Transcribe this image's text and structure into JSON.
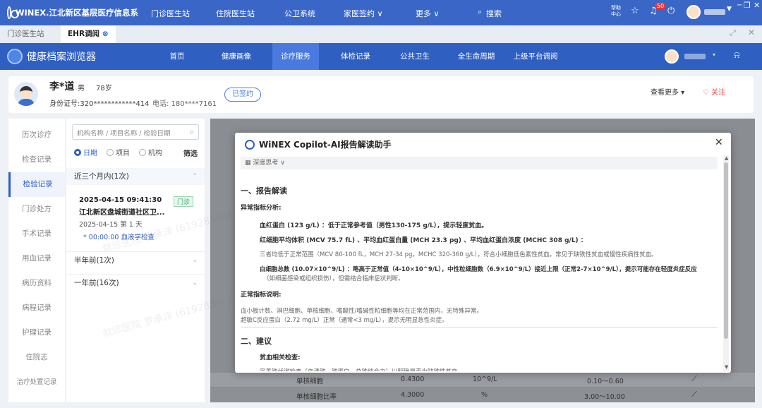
{
  "topbar": {
    "logo": "WINEX.江北新区基层医疗信息系",
    "nav": [
      "门诊医生站",
      "住院医生站",
      "公卫系统",
      "家医签约 ∨",
      "更多 ∨",
      "搜索"
    ],
    "help": "帮助中心",
    "notice_badge": "50"
  },
  "tabs": [
    "门诊医生站",
    "EHR调阅"
  ],
  "app": {
    "title": "健康档案浏览器",
    "nav": [
      "首页",
      "健康画像",
      "诊疗服务",
      "体检记录",
      "公共卫生",
      "全生命周期",
      "上级平台调阅"
    ]
  },
  "patient": {
    "name": "李*道",
    "sex": "男",
    "age": "78岁",
    "id": "身份证号:320************414",
    "phone": "电话: 180****7161",
    "status": "已签约",
    "more": "查看更多 ▾",
    "follow": "关注"
  },
  "sidebar": [
    "历次诊疗",
    "检查记录",
    "检验记录",
    "门诊处方",
    "手术记录",
    "用血记录",
    "病历资料",
    "病程记录",
    "护理记录",
    "住院志",
    "治疗处置记录"
  ],
  "filter": {
    "placeholder": "机构名称 / 项目名称 / 检验日期",
    "radios": [
      "日期",
      "项目",
      "机构"
    ],
    "screen": "筛选",
    "groups": [
      "近三个月内(1次)",
      "半年前(1次)",
      "一年前(16次)"
    ],
    "record": {
      "datetime": "2025-04-15 09:41:30",
      "tag": "门诊",
      "org": "江北新区盘城街道社区卫...",
      "day": "2025-04-15 第 1 天",
      "item": "* 00:00:00 血液学检查"
    }
  },
  "table_rows": [
    [
      "单核细胞",
      "0.4300",
      "10^9/L",
      "0.10～0.60"
    ],
    [
      "单核细胞比率",
      "4.3000",
      "%",
      "3.00～10.00"
    ]
  ],
  "watermark": "就诊医院 罗承洋 (619285068) 2025-04-30 15:01",
  "modal": {
    "title": "WiNEX Copilot-AI报告解读助手",
    "think": "深度思考 ∨",
    "lines": [
      "一、报告解读",
      "异常指标分析:",
      "血红蛋白 (123 g/L) ：低于正常参考值（男性130-175 g/L），提示轻度贫血。",
      "红细胞平均体积 (MCV 75.7 fL) 、平均血红蛋白量 (MCH 23.3 pg) 、平均血红蛋白浓度 (MCHC 308 g/L) ：",
      "三者均低于正常范围（MCV 80-100 fL，MCH 27-34 pg，MCHC 320-360 g/L），符合小细胞低色素性贫血，常见于缺铁性贫血或慢性疾病性贫血。",
      "白细胞总数 (10.07×10^9/L) ：略高于正常值（4-10×10^9/L），中性粒细胞数（6.9×10^9/L）接近上限（正常2-7×10^9/L），提示可能存在轻度炎症反应",
      "（如细菌感染或组织损伤），但需结合临床症状判断。",
      "正常指标说明:",
      "血小板计数、淋巴细胞、单核细胞、嗜酸性/嗜碱性粒细胞等均在正常范围内，无特殊异常。",
      "超敏C反应蛋白（2.72 mg/L）正常（通常<3 mg/L），提示无明显急性炎症。",
      "二、建议",
      "贫血相关检查:",
      "完善铁代谢检查（血清铁、铁蛋白、总铁结合力）以明确是否为缺铁性贫血。"
    ]
  }
}
